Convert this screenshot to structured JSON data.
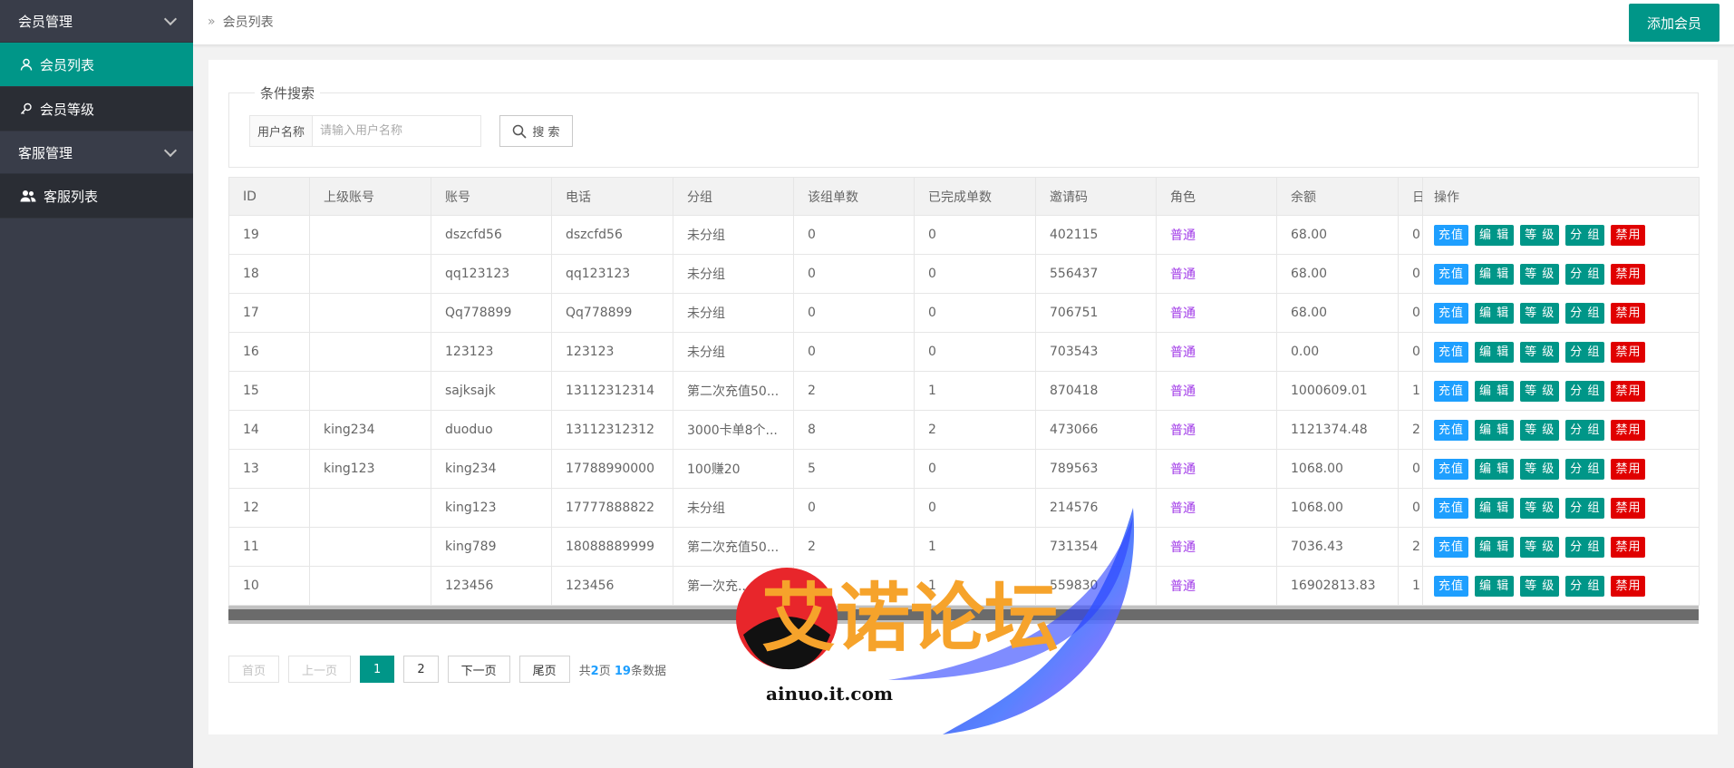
{
  "sidebar": {
    "groups": [
      {
        "label": "会员管理",
        "items": [
          {
            "label": "会员列表"
          },
          {
            "label": "会员等级"
          }
        ]
      },
      {
        "label": "客服管理",
        "items": [
          {
            "label": "客服列表"
          }
        ]
      }
    ]
  },
  "header": {
    "breadcrumb": "会员列表",
    "add_label": "添加会员"
  },
  "search": {
    "legend": "条件搜索",
    "label": "用户名称",
    "placeholder": "请输入用户名称",
    "button": "搜 索"
  },
  "table": {
    "columns": [
      "ID",
      "上级账号",
      "账号",
      "电话",
      "分组",
      "该组单数",
      "已完成单数",
      "邀请码",
      "角色",
      "余额",
      "日",
      "操作"
    ],
    "rows": [
      [
        "19",
        "",
        "dszcfd56",
        "dszcfd56",
        "未分组",
        "0",
        "0",
        "402115",
        "普通",
        "68.00",
        "0"
      ],
      [
        "18",
        "",
        "qq123123",
        "qq123123",
        "未分组",
        "0",
        "0",
        "556437",
        "普通",
        "68.00",
        "0"
      ],
      [
        "17",
        "",
        "Qq778899",
        "Qq778899",
        "未分组",
        "0",
        "0",
        "706751",
        "普通",
        "68.00",
        "0"
      ],
      [
        "16",
        "",
        "123123",
        "123123",
        "未分组",
        "0",
        "0",
        "703543",
        "普通",
        "0.00",
        "0"
      ],
      [
        "15",
        "",
        "sajksajk",
        "13112312314",
        "第二次充值50...",
        "2",
        "1",
        "870418",
        "普通",
        "1000609.01",
        "1"
      ],
      [
        "14",
        "king234",
        "duoduo",
        "13112312312",
        "3000卡单8个...",
        "8",
        "2",
        "473066",
        "普通",
        "1121374.48",
        "2"
      ],
      [
        "13",
        "king123",
        "king234",
        "17788990000",
        "100赚20",
        "5",
        "0",
        "789563",
        "普通",
        "1068.00",
        "0"
      ],
      [
        "12",
        "",
        "king123",
        "17777888822",
        "未分组",
        "0",
        "0",
        "214576",
        "普通",
        "1068.00",
        "0"
      ],
      [
        "11",
        "",
        "king789",
        "18088889999",
        "第二次充值50...",
        "2",
        "1",
        "731354",
        "普通",
        "7036.43",
        "2"
      ],
      [
        "10",
        "",
        "123456",
        "123456",
        "第一次充...",
        "2",
        "1",
        "559830",
        "普通",
        "16902813.83",
        "1"
      ]
    ],
    "actions": [
      "充值",
      "编 辑",
      "等 级",
      "分 组",
      "禁用"
    ]
  },
  "pager": {
    "first": "首页",
    "prev": "上一页",
    "pages": [
      "1",
      "2"
    ],
    "current": "1",
    "next": "下一页",
    "last": "尾页",
    "info_prefix": "共",
    "total_pages": "2",
    "info_mid": "页",
    "total_records": "19",
    "info_suffix": "条数据"
  },
  "watermark": {
    "title": "艾诺论坛",
    "url": "ainuo.it.com"
  },
  "colors": {
    "primary": "#009688",
    "sidebar": "#393d49",
    "blue": "#1e9fff",
    "red": "#e00000",
    "role": "#a23ce8"
  }
}
